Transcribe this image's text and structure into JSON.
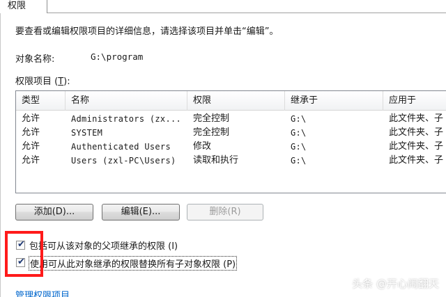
{
  "tab": {
    "label": "权限"
  },
  "intro_text": "要查看或编辑权限项目的详细信息，请选择该项目并单击“编辑”。",
  "object_name": {
    "label": "对象名称:",
    "value": "G:\\program"
  },
  "entries_label": {
    "text": "权限项目 (",
    "accel": "T",
    "suffix": "):"
  },
  "table": {
    "columns": [
      "类型",
      "名称",
      "权限",
      "继承于",
      "应用于"
    ],
    "rows": [
      [
        "允许",
        "Administrators (zx...",
        "完全控制",
        "G:\\",
        "此文件夹、子"
      ],
      [
        "允许",
        "SYSTEM",
        "完全控制",
        "G:\\",
        "此文件夹、子"
      ],
      [
        "允许",
        "Authenticated Users",
        "修改",
        "G:\\",
        "此文件夹、子"
      ],
      [
        "允许",
        "Users (zxl-PC\\Users)",
        "读取和执行",
        "G:\\",
        "此文件夹、子"
      ]
    ]
  },
  "buttons": {
    "add": "添加(D)...",
    "edit": "编辑(E)...",
    "remove": "删除(R)"
  },
  "checkboxes": [
    {
      "label": "包括可从该对象的父项继承的权限 (I)",
      "checked": true
    },
    {
      "label": "使用可从此对象继承的权限替换所有子对象权限 (P)",
      "checked": true
    }
  ],
  "link": "管理权限项目",
  "watermark": "头条 @开心闹翻天",
  "colors": {
    "highlight": "#ff1a1a",
    "link": "#0066cc"
  }
}
